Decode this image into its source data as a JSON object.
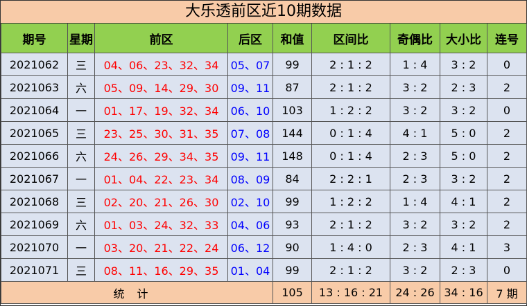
{
  "title": "大乐透前区近10期数据",
  "headers": [
    "期号",
    "星期",
    "前区",
    "后区",
    "和值",
    "区间比",
    "奇偶比",
    "大小比",
    "连号"
  ],
  "rows": [
    {
      "issue": "2021062",
      "weekday": "三",
      "front": "04、06、23、32、34",
      "back": "05、07",
      "sum": "99",
      "zone": "2 : 1 : 2",
      "oddeven": "1 : 4",
      "bigsmall": "3 : 2",
      "consec": "0"
    },
    {
      "issue": "2021063",
      "weekday": "六",
      "front": "05、09、14、29、30",
      "back": "09、11",
      "sum": "87",
      "zone": "2 : 1 : 2",
      "oddeven": "3 : 2",
      "bigsmall": "2 : 3",
      "consec": "2"
    },
    {
      "issue": "2021064",
      "weekday": "一",
      "front": "01、17、19、32、34",
      "back": "06、10",
      "sum": "103",
      "zone": "1 : 2 : 2",
      "oddeven": "3 : 2",
      "bigsmall": "3 : 2",
      "consec": "0"
    },
    {
      "issue": "2021065",
      "weekday": "三",
      "front": "23、25、30、31、35",
      "back": "07、08",
      "sum": "144",
      "zone": "0 : 1 : 4",
      "oddeven": "4 : 1",
      "bigsmall": "5 : 0",
      "consec": "2"
    },
    {
      "issue": "2021066",
      "weekday": "六",
      "front": "24、26、29、34、35",
      "back": "09、11",
      "sum": "148",
      "zone": "0 : 1 : 4",
      "oddeven": "2 : 3",
      "bigsmall": "5 : 0",
      "consec": "2"
    },
    {
      "issue": "2021067",
      "weekday": "一",
      "front": "01、04、22、23、34",
      "back": "08、09",
      "sum": "84",
      "zone": "2 : 2 : 1",
      "oddeven": "2 : 3",
      "bigsmall": "3 : 2",
      "consec": "2"
    },
    {
      "issue": "2021068",
      "weekday": "三",
      "front": "02、20、21、26、30",
      "back": "02、10",
      "sum": "99",
      "zone": "1 : 2 : 2",
      "oddeven": "1 : 4",
      "bigsmall": "4 : 1",
      "consec": "2"
    },
    {
      "issue": "2021069",
      "weekday": "六",
      "front": "01、03、24、32、33",
      "back": "04、06",
      "sum": "93",
      "zone": "2 : 1 : 2",
      "oddeven": "3 : 2",
      "bigsmall": "3 : 2",
      "consec": "2"
    },
    {
      "issue": "2021070",
      "weekday": "一",
      "front": "03、20、21、22、24",
      "back": "06、12",
      "sum": "90",
      "zone": "1 : 4 : 0",
      "oddeven": "2 : 3",
      "bigsmall": "4 : 1",
      "consec": "3"
    },
    {
      "issue": "2021071",
      "weekday": "三",
      "front": "08、11、16、29、35",
      "back": "01、04",
      "sum": "99",
      "zone": "2 : 1 : 2",
      "oddeven": "3 : 2",
      "bigsmall": "2 : 3",
      "consec": "0"
    }
  ],
  "footer": {
    "label": "统计",
    "sum": "105",
    "zone": "13 : 16 : 21",
    "oddeven": "24 : 26",
    "bigsmall": "34 : 16",
    "consec": "7 期"
  },
  "colors": {
    "header_bg": "#92d050",
    "title_bg": "#f8cba8",
    "row_bg": "#dce3f0",
    "front_color": "#ff0000",
    "back_color": "#0000ff"
  }
}
